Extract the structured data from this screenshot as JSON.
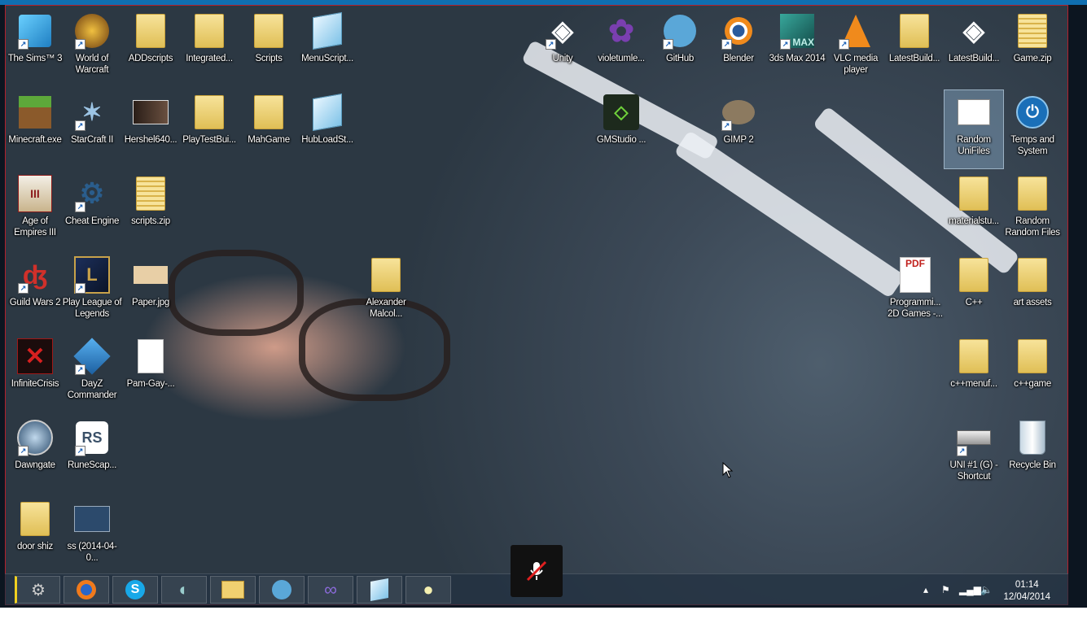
{
  "desktop": {
    "icons": [
      {
        "label": "The Sims™ 3",
        "icon": "sims-icon"
      },
      {
        "label": "World of Warcraft",
        "icon": "wow-icon"
      },
      {
        "label": "ADDscripts",
        "icon": "folder-icon"
      },
      {
        "label": "Integrated...",
        "icon": "folder-icon"
      },
      {
        "label": "Scripts",
        "icon": "folder-icon"
      },
      {
        "label": "MenuScript...",
        "icon": "notepad-icon"
      },
      {
        "label": "Minecraft.exe",
        "icon": "minecraft-icon"
      },
      {
        "label": "StarCraft II",
        "icon": "starcraft-icon"
      },
      {
        "label": "Hershel640...",
        "icon": "image-icon"
      },
      {
        "label": "PlayTestBui...",
        "icon": "folder-icon"
      },
      {
        "label": "MahGame",
        "icon": "folder-icon"
      },
      {
        "label": "HubLoadSt...",
        "icon": "notepad-icon"
      },
      {
        "label": "Age of Empires III",
        "icon": "age-of-empires-icon"
      },
      {
        "label": "Cheat Engine",
        "icon": "cheat-engine-icon"
      },
      {
        "label": "scripts.zip",
        "icon": "zip-folder-icon"
      },
      {
        "label": "Guild Wars 2",
        "icon": "guild-wars-icon"
      },
      {
        "label": "Play League of Legends",
        "icon": "league-icon"
      },
      {
        "label": "Paper.jpg",
        "icon": "jpg-icon"
      },
      {
        "label": "Alexander Malcol...",
        "icon": "folder-icon"
      },
      {
        "label": "InfiniteCrisis",
        "icon": "infinite-crisis-icon"
      },
      {
        "label": "DayZ Commander",
        "icon": "dayz-icon"
      },
      {
        "label": "Pam-Gay-...",
        "icon": "file-icon"
      },
      {
        "label": "Dawngate",
        "icon": "dawngate-icon"
      },
      {
        "label": "RuneScap...",
        "icon": "runescape-icon"
      },
      {
        "label": "door shiz",
        "icon": "folder-icon"
      },
      {
        "label": "ss (2014-04-0...",
        "icon": "screenshot-icon"
      },
      {
        "label": "Unity",
        "icon": "unity-icon"
      },
      {
        "label": "violetumle...",
        "icon": "violet-icon"
      },
      {
        "label": "GitHub",
        "icon": "github-icon"
      },
      {
        "label": "Blender",
        "icon": "blender-icon"
      },
      {
        "label": "3ds Max 2014",
        "icon": "3dsmax-icon"
      },
      {
        "label": "VLC media player",
        "icon": "vlc-icon"
      },
      {
        "label": "LatestBuild...",
        "icon": "folder-icon"
      },
      {
        "label": "LatestBuild...",
        "icon": "unity-icon"
      },
      {
        "label": "Game.zip",
        "icon": "zip-folder-icon"
      },
      {
        "label": "GMStudio ...",
        "icon": "gamemaker-icon"
      },
      {
        "label": "GIMP 2",
        "icon": "gimp-icon"
      },
      {
        "label": "Random UniFiles",
        "icon": "presentation-icon"
      },
      {
        "label": "Temps and System",
        "icon": "power-icon"
      },
      {
        "label": "materialstu...",
        "icon": "folder-icon"
      },
      {
        "label": "Random Random Files",
        "icon": "folder-icon"
      },
      {
        "label": "Programmi... 2D Games -...",
        "icon": "pdf-icon"
      },
      {
        "label": "C++",
        "icon": "folder-icon"
      },
      {
        "label": "art assets",
        "icon": "folder-icon"
      },
      {
        "label": "c++menuf...",
        "icon": "folder-icon"
      },
      {
        "label": "c++game",
        "icon": "folder-icon"
      },
      {
        "label": "UNI #1 (G) - Shortcut",
        "icon": "drive-icon"
      },
      {
        "label": "Recycle Bin",
        "icon": "recycle-bin-icon"
      }
    ]
  },
  "taskbar": {
    "apps": [
      "steam-icon",
      "firefox-icon",
      "skype-icon",
      "teamviewer-icon",
      "file-explorer-icon",
      "github-icon",
      "visual-studio-icon",
      "notepad-icon",
      "pin-icon"
    ],
    "clock_time": "01:14",
    "clock_date": "12/04/2014"
  },
  "overlay": {
    "mic_muted": true
  },
  "colors": {
    "accent": "#0f6fb1",
    "selection": "#a0c8eb"
  }
}
